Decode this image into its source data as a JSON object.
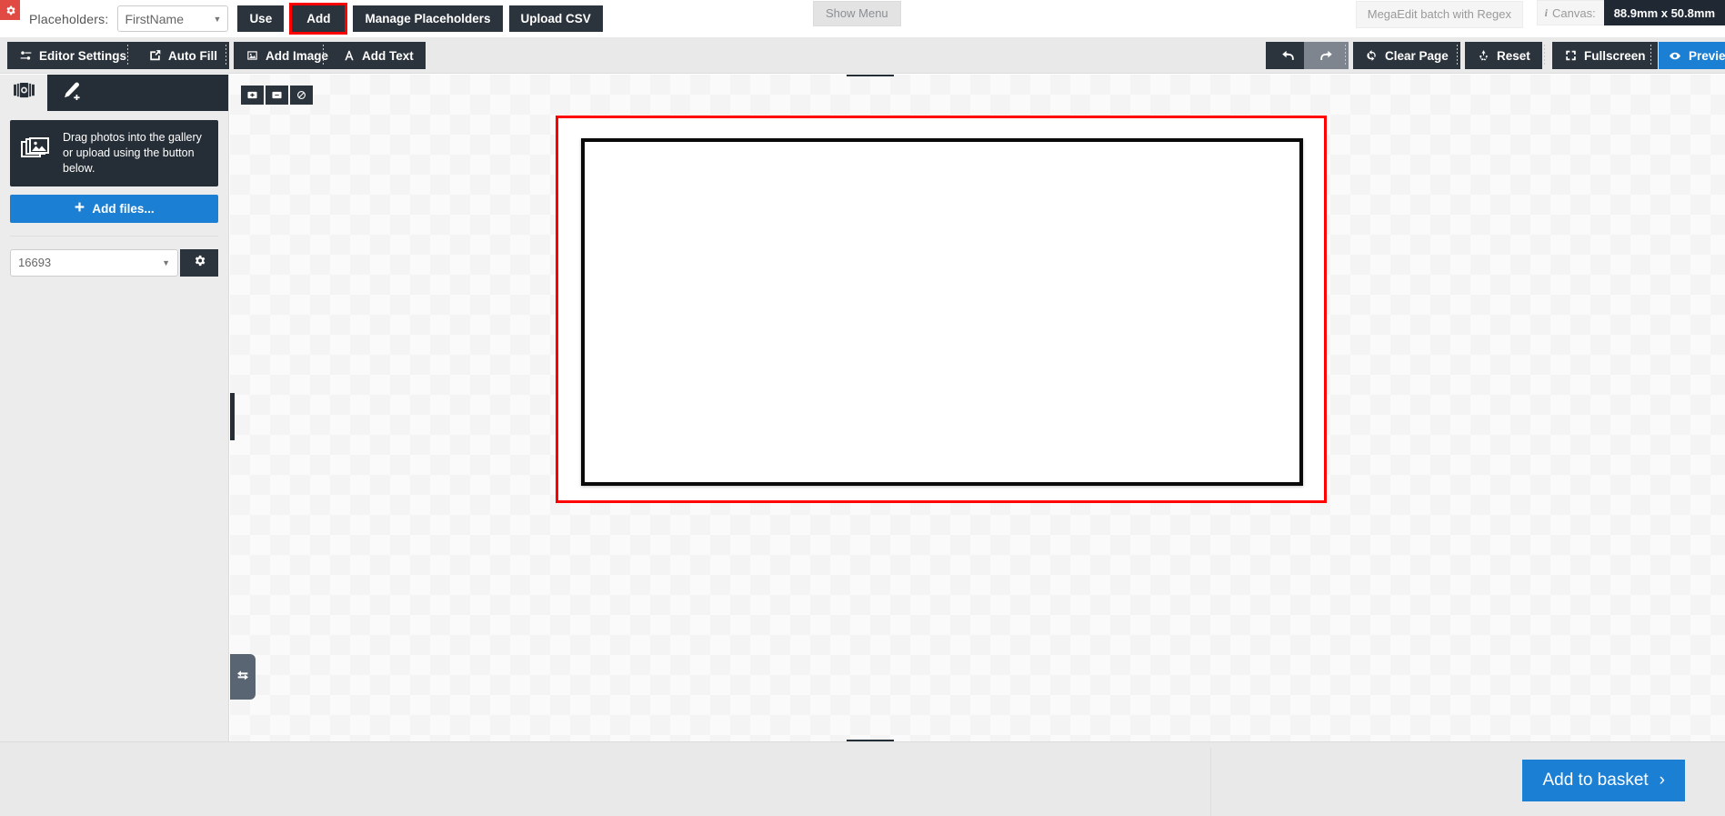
{
  "topbar": {
    "gear_icon": "gear-icon",
    "placeholders_label": "Placeholders:",
    "placeholder_value": "FirstName",
    "use_label": "Use",
    "add_label": "Add",
    "manage_label": "Manage Placeholders",
    "upload_csv_label": "Upload CSV",
    "show_menu_label": "Show Menu",
    "mega_edit_label": "MegaEdit batch with Regex",
    "canvas_label": "Canvas:",
    "canvas_value": "88.9mm x 50.8mm",
    "add_highlight_color": "#ff0000"
  },
  "toolbar": {
    "editor_settings_label": "Editor Settings",
    "auto_fill_label": "Auto Fill",
    "add_image_label": "Add Image",
    "add_text_label": "Add Text",
    "undo_label": "undo-icon",
    "redo_label": "redo-icon",
    "clear_page_label": "Clear Page",
    "reset_label": "Reset",
    "fullscreen_label": "Fullscreen",
    "preview_label": "Preview"
  },
  "left_panel": {
    "tabs": [
      {
        "icon": "photos-icon",
        "active": true
      },
      {
        "icon": "pen-add-icon",
        "active": false
      }
    ],
    "drag_hint": "Drag photos into the gallery or upload using the button below.",
    "add_files_label": "Add files...",
    "gallery_select_value": "16693",
    "gallery_gear_icon": "gear-icon"
  },
  "workspace": {
    "zoom_in_label": "zoom-in",
    "zoom_out_label": "zoom-out",
    "zoom_reset_label": "zoom-none",
    "page_border_color": "#ff0000",
    "frame_color": "#0a0a0a"
  },
  "bottombar": {
    "add_to_basket_label": "Add to basket",
    "chevron": "›"
  }
}
